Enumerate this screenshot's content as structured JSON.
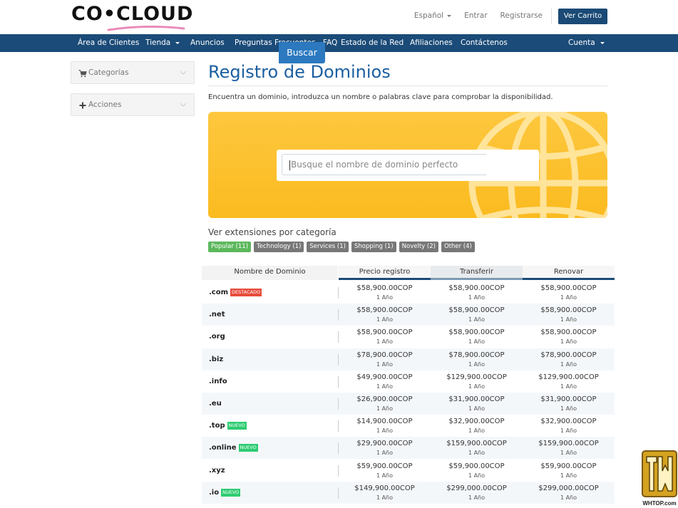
{
  "brand": {
    "logo_text": "CO•CLOUD"
  },
  "header": {
    "language": "Español",
    "login": "Entrar",
    "register": "Registrarse",
    "cart": "Ver Carrito"
  },
  "nav": {
    "items": [
      {
        "label": "Área de Clientes",
        "dropdown": false
      },
      {
        "label": "Tienda",
        "dropdown": true
      },
      {
        "label": "Anuncios",
        "dropdown": false
      },
      {
        "label": "Preguntas Frecuentes - FAQ",
        "dropdown": false
      },
      {
        "label": "Estado de la Red",
        "dropdown": false
      },
      {
        "label": "Afiliaciones",
        "dropdown": false
      },
      {
        "label": "Contáctenos",
        "dropdown": false
      }
    ],
    "account": "Cuenta"
  },
  "sidebar": {
    "categories": "Categorías",
    "actions": "Acciones"
  },
  "main": {
    "title": "Registro de Dominios",
    "intro": "Encuentra un dominio, introduzca un nombre o palabras clave para comprobar la disponibilidad.",
    "search_placeholder": "Busque el nombre de dominio perfecto",
    "search_button": "Buscar",
    "categories_title": "Ver extensiones por categoría",
    "categories": [
      {
        "label": "Popular (11)",
        "active": true
      },
      {
        "label": "Technology (1)",
        "active": false
      },
      {
        "label": "Services (1)",
        "active": false
      },
      {
        "label": "Shopping (1)",
        "active": false
      },
      {
        "label": "Novelty (2)",
        "active": false
      },
      {
        "label": "Other (4)",
        "active": false
      }
    ]
  },
  "table": {
    "headers": {
      "domain": "Nombre de Dominio",
      "register": "Precio registro",
      "transfer": "Transferir",
      "renew": "Renovar"
    },
    "rows": [
      {
        "tld": ".com",
        "badge": "DESTACADO",
        "badge_type": "hot",
        "register": "$58,900.00COP",
        "transfer": "$58,900.00COP",
        "renew": "$58,900.00COP",
        "period": "1 Año"
      },
      {
        "tld": ".net",
        "badge": "",
        "badge_type": "",
        "register": "$58,900.00COP",
        "transfer": "$58,900.00COP",
        "renew": "$58,900.00COP",
        "period": "1 Año"
      },
      {
        "tld": ".org",
        "badge": "",
        "badge_type": "",
        "register": "$58,900.00COP",
        "transfer": "$58,900.00COP",
        "renew": "$58,900.00COP",
        "period": "1 Año"
      },
      {
        "tld": ".biz",
        "badge": "",
        "badge_type": "",
        "register": "$78,900.00COP",
        "transfer": "$78,900.00COP",
        "renew": "$78,900.00COP",
        "period": "1 Año"
      },
      {
        "tld": ".info",
        "badge": "",
        "badge_type": "",
        "register": "$49,900.00COP",
        "transfer": "$129,900.00COP",
        "renew": "$129,900.00COP",
        "period": "1 Año"
      },
      {
        "tld": ".eu",
        "badge": "",
        "badge_type": "",
        "register": "$26,900.00COP",
        "transfer": "$31,900.00COP",
        "renew": "$31,900.00COP",
        "period": "1 Año"
      },
      {
        "tld": ".top",
        "badge": "NUEVO",
        "badge_type": "new",
        "register": "$14,900.00COP",
        "transfer": "$32,900.00COP",
        "renew": "$32,900.00COP",
        "period": "1 Año"
      },
      {
        "tld": ".online",
        "badge": "NUEVO",
        "badge_type": "new",
        "register": "$29,900.00COP",
        "transfer": "$159,900.00COP",
        "renew": "$159,900.00COP",
        "period": "1 Año"
      },
      {
        "tld": ".xyz",
        "badge": "",
        "badge_type": "",
        "register": "$59,900.00COP",
        "transfer": "$59,900.00COP",
        "renew": "$59,900.00COP",
        "period": "1 Año"
      },
      {
        "tld": ".io",
        "badge": "NUEVO",
        "badge_type": "new",
        "register": "$149,900.00COP",
        "transfer": "$299,000.00COP",
        "renew": "$299,000.00COP",
        "period": "1 Año"
      }
    ]
  },
  "watermark": {
    "text": "WHTOP.com"
  },
  "colors": {
    "primary": "#1b4b78",
    "title": "#1b5fa0",
    "hero": "#fbbb20",
    "search_button": "#2c79c0",
    "tag_active": "#5cb85c",
    "tag": "#777777",
    "badge_hot": "#e74c3c",
    "badge_new": "#2ecc71"
  }
}
